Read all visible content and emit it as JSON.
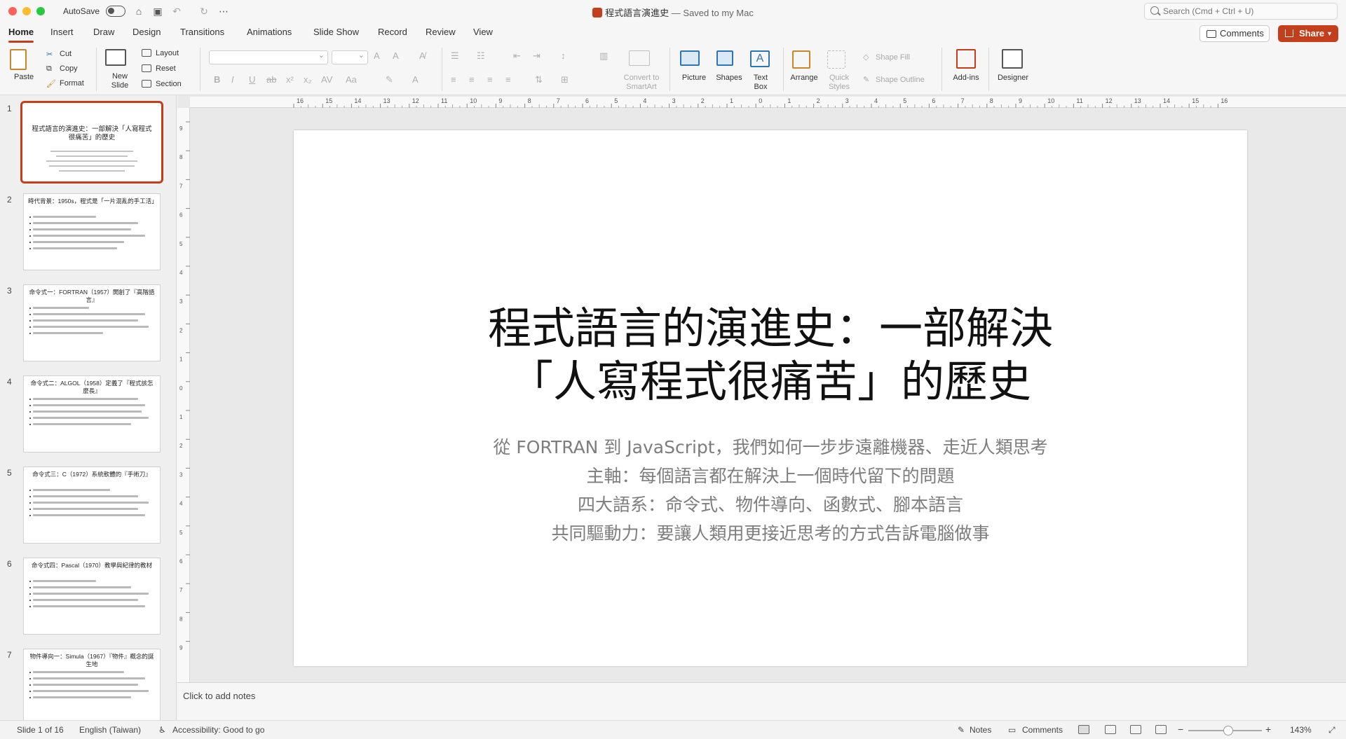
{
  "window": {
    "autosave_label": "AutoSave",
    "doc_name": "程式語言演進史",
    "saved_status": "— Saved to my Mac",
    "search_placeholder": "Search (Cmd + Ctrl + U)"
  },
  "tabs": [
    "Home",
    "Insert",
    "Draw",
    "Design",
    "Transitions",
    "Animations",
    "Slide Show",
    "Record",
    "Review",
    "View"
  ],
  "active_tab": "Home",
  "header_buttons": {
    "comments": "Comments",
    "share": "Share"
  },
  "ribbon": {
    "paste": "Paste",
    "cut": "Cut",
    "copy": "Copy",
    "format": "Format",
    "new_slide": "New\nSlide",
    "layout": "Layout",
    "reset": "Reset",
    "section": "Section",
    "convert_smartart": "Convert to\nSmartArt",
    "picture": "Picture",
    "shapes": "Shapes",
    "text_box": "Text\nBox",
    "arrange": "Arrange",
    "quick_styles": "Quick\nStyles",
    "shape_fill": "Shape Fill",
    "shape_outline": "Shape Outline",
    "add_ins": "Add-ins",
    "designer": "Designer"
  },
  "ruler": {
    "h_ticks": [
      "16",
      "15",
      "14",
      "13",
      "12",
      "11",
      "10",
      "9",
      "8",
      "7",
      "6",
      "5",
      "4",
      "3",
      "2",
      "1",
      "0",
      "1",
      "2",
      "3",
      "4",
      "5",
      "6",
      "7",
      "8",
      "9",
      "10",
      "11",
      "12",
      "13",
      "14",
      "15",
      "16"
    ],
    "v_ticks": [
      "9",
      "8",
      "7",
      "6",
      "5",
      "4",
      "3",
      "2",
      "1",
      "0",
      "1",
      "2",
      "3",
      "4",
      "5",
      "6",
      "7",
      "8",
      "9"
    ]
  },
  "thumbnails": [
    {
      "num": "1",
      "title": "程式語言的演進史：一部解決「人寫程式很痛苦」的歷史",
      "selected": true
    },
    {
      "num": "2",
      "title": "時代背景：1950s，程式是「一片混亂的手工活」"
    },
    {
      "num": "3",
      "title": "命令式一：FORTRAN（1957）開創了『高階語言』"
    },
    {
      "num": "4",
      "title": "命令式二：ALGOL（1958）定義了『程式該怎麼長』"
    },
    {
      "num": "5",
      "title": "命令式三：C（1972）系統軟體的『手術刀』"
    },
    {
      "num": "6",
      "title": "命令式四：Pascal（1970）教學與紀律的教材"
    },
    {
      "num": "7",
      "title": "物件導向一：Simula（1967）『物件』概念的誕生地"
    }
  ],
  "slide": {
    "title": "程式語言的演進史：一部解決\n「人寫程式很痛苦」的歷史",
    "subtitle": [
      "從 FORTRAN 到 JavaScript，我們如何一步步遠離機器、走近人類思考",
      "主軸：每個語言都在解決上一個時代留下的問題",
      "四大語系：命令式、物件導向、函數式、腳本語言",
      "共同驅動力：要讓人類用更接近思考的方式告訴電腦做事"
    ]
  },
  "notes_placeholder": "Click to add notes",
  "status": {
    "slide_of": "Slide 1 of 16",
    "language": "English (Taiwan)",
    "accessibility": "Accessibility: Good to go",
    "notes": "Notes",
    "comments": "Comments",
    "zoom": "143%"
  },
  "colors": {
    "accent": "#c43e1c"
  }
}
